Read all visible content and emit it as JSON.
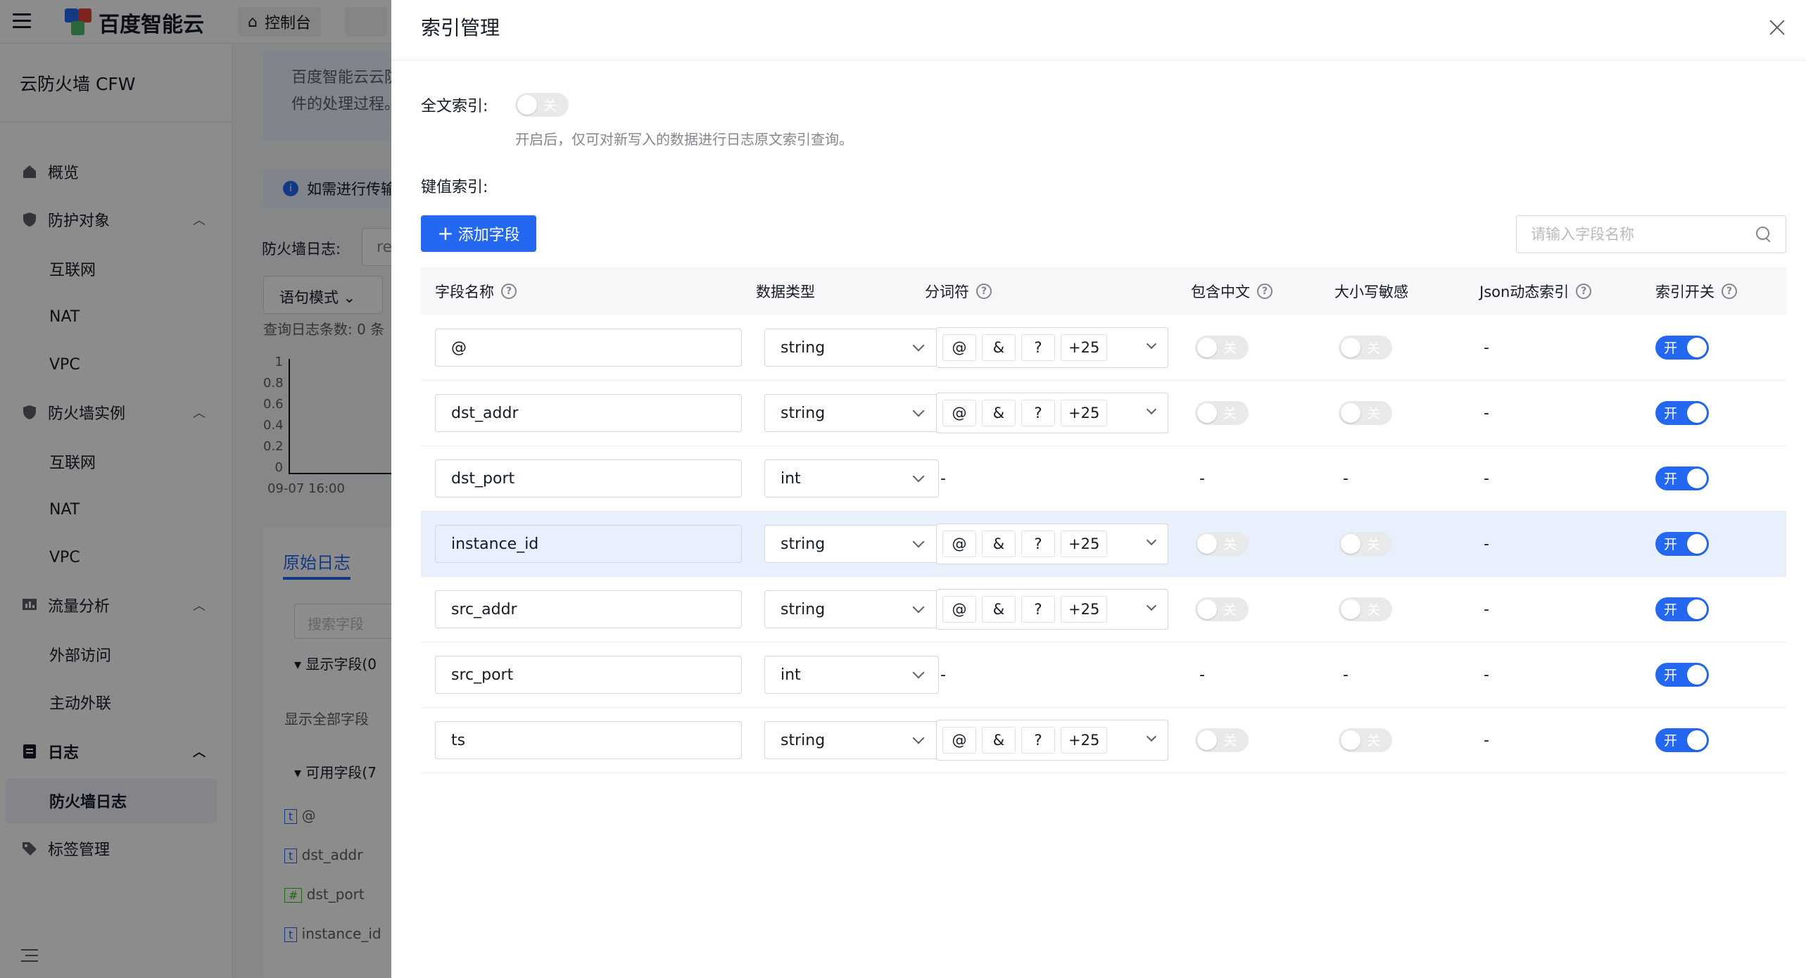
{
  "topbar": {
    "brand": "百度智能云",
    "console": "控制台"
  },
  "sidebar": {
    "product": "云防火墙 CFW",
    "items": [
      {
        "label": "概览",
        "icon": "home-icon"
      },
      {
        "label": "防护对象",
        "icon": "shield-icon"
      },
      {
        "label": "防火墙实例",
        "icon": "shield-icon"
      },
      {
        "label": "流量分析",
        "icon": "chart-icon"
      },
      {
        "label": "日志",
        "icon": "document-icon"
      },
      {
        "label": "标签管理",
        "icon": "tag-icon"
      }
    ],
    "sub_protect": [
      "互联网",
      "NAT",
      "VPC"
    ],
    "sub_instance": [
      "互联网",
      "NAT",
      "VPC"
    ],
    "sub_traffic": [
      "外部访问",
      "主动外联"
    ],
    "sub_log": [
      "防火墙日志"
    ]
  },
  "background": {
    "intro_text_1": "百度智能云云防",
    "intro_text_2": "件的处理过程。",
    "notice": "如需进行传输",
    "firewall_log_label": "防火墙日志:",
    "firewall_log_value": "re",
    "query_mode": "语句模式",
    "log_count": "查询日志条数: 0 条",
    "y_ticks": [
      "1",
      "0.8",
      "0.6",
      "0.4",
      "0.2",
      "0"
    ],
    "x_tick": "09-07 16:00",
    "tab_raw": "原始日志",
    "search_field_placeholder": "搜索字段",
    "display_fields": "显示字段(0",
    "show_all_fields": "显示全部字段",
    "available_fields": "可用字段(7",
    "fields": [
      {
        "type": "t",
        "name": "@"
      },
      {
        "type": "t",
        "name": "dst_addr"
      },
      {
        "type": "#",
        "name": "dst_port"
      },
      {
        "type": "t",
        "name": "instance_id"
      }
    ]
  },
  "drawer": {
    "title": "索引管理",
    "fulltext_label": "全文索引:",
    "fulltext_toggle": "关",
    "fulltext_hint": "开启后，仅可对新写入的数据进行日志原文索引查询。",
    "kv_label": "键值索引:",
    "add_field": "添加字段",
    "search_placeholder": "请输入字段名称",
    "columns": [
      "字段名称",
      "数据类型",
      "分词符",
      "包含中文",
      "大小写敏感",
      "Json动态索引",
      "索引开关"
    ],
    "rows": [
      {
        "name": "@",
        "type": "string",
        "tokens": [
          "@",
          "&",
          "?",
          "+25"
        ],
        "chinese": "关",
        "case": "关",
        "json": "-",
        "enabled": "开"
      },
      {
        "name": "dst_addr",
        "type": "string",
        "tokens": [
          "@",
          "&",
          "?",
          "+25"
        ],
        "chinese": "关",
        "case": "关",
        "json": "-",
        "enabled": "开"
      },
      {
        "name": "dst_port",
        "type": "int",
        "tokens_text": "-",
        "chinese_text": "-",
        "case_text": "-",
        "json": "-",
        "enabled": "开"
      },
      {
        "name": "instance_id",
        "type": "string",
        "tokens": [
          "@",
          "&",
          "?",
          "+25"
        ],
        "chinese": "关",
        "case": "关",
        "json": "-",
        "enabled": "开"
      },
      {
        "name": "src_addr",
        "type": "string",
        "tokens": [
          "@",
          "&",
          "?",
          "+25"
        ],
        "chinese": "关",
        "case": "关",
        "json": "-",
        "enabled": "开"
      },
      {
        "name": "src_port",
        "type": "int",
        "tokens_text": "-",
        "chinese_text": "-",
        "case_text": "-",
        "json": "-",
        "enabled": "开"
      },
      {
        "name": "ts",
        "type": "string",
        "tokens": [
          "@",
          "&",
          "?",
          "+25"
        ],
        "chinese": "关",
        "case": "关",
        "json": "-",
        "enabled": "开"
      }
    ]
  },
  "colors": {
    "primary": "#2468f2",
    "highlight_row": "#e8f0fe",
    "overlay": "rgba(0,0,0,0.45)"
  }
}
